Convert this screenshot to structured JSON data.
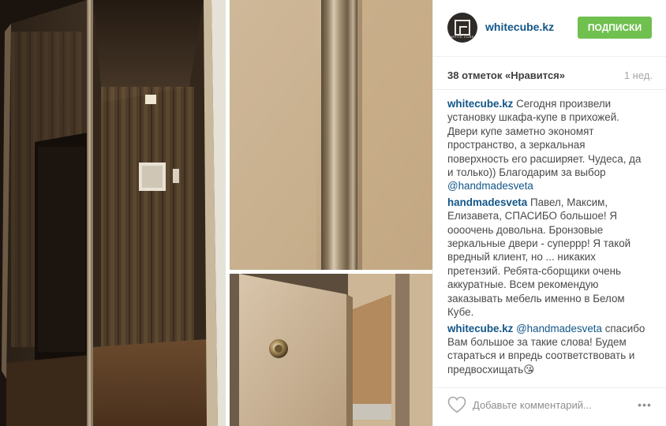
{
  "account": {
    "username": "whitecube.kz",
    "avatar_text": "WHITE CUBE",
    "follow_label": "ПОДПИСКИ"
  },
  "stats": {
    "likes": "38 отметок «Нравится»",
    "time": "1 нед."
  },
  "comments": [
    {
      "user": "whitecube.kz",
      "text": " Сегодня произвели установку шкафа-купе в прихожей. Двери купе заметно экономят пространство, а зеркальная поверхность его расширяет. Чудеса, да и только)) Благодарим за выбор ",
      "mention": "@handmadesveta",
      "text_after": ""
    },
    {
      "user": "handmadesveta",
      "text": " Павел, Максим, Елизавета, СПАСИБО большое! Я оооочень довольна. Бронзовые зеркальные двери - суперрр! Я такой вредный клиент, но ... никаких претензий. Ребята-сборщики очень аккуратные. Всем рекомендую заказывать мебель именно в Белом Кубе.",
      "mention": "",
      "text_after": ""
    },
    {
      "user": "whitecube.kz",
      "text": " ",
      "mention": "@handmadesveta",
      "text_after": " спасибо Вам большое за такие слова! Будем стараться и впредь соответствовать и предвосхищать😘"
    }
  ],
  "footer": {
    "comment_placeholder": "Добавьте комментарий...",
    "more_label": "•••"
  },
  "icons": {
    "like": "heart-outline-icon",
    "more": "ellipsis-icon"
  },
  "colors": {
    "link": "#125688",
    "follow": "#70c050",
    "muted": "#a5a7aa"
  }
}
